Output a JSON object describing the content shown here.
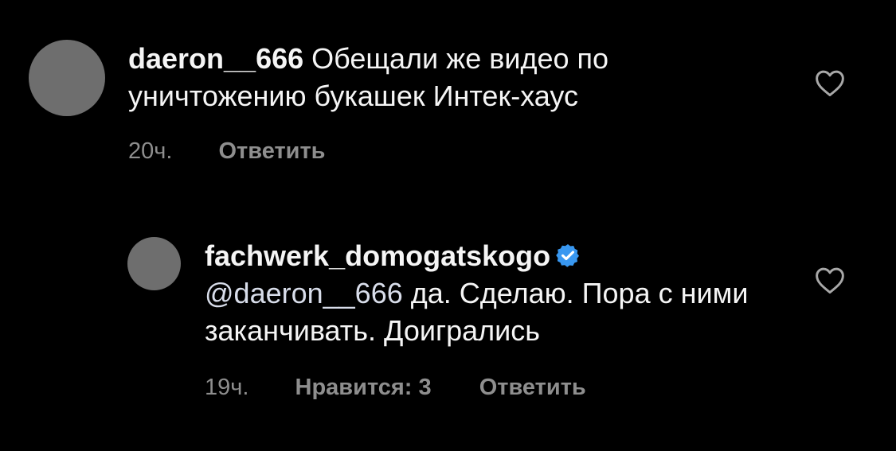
{
  "comments": [
    {
      "username": "daeron__666",
      "text": "Обещали же видео по уничтожению букашек Интек-хаус",
      "time": "20ч.",
      "reply_label": "Ответить"
    },
    {
      "username": "fachwerk_domogatskogo",
      "verified": true,
      "mention": "@daeron__666",
      "text": "да. Сделаю. Пора с ними заканчивать. Доигрались",
      "time": "19ч.",
      "likes_label": "Нравится: 3",
      "reply_label": "Ответить"
    }
  ],
  "icons": {
    "like": "heart-outline-icon",
    "verified": "verified-badge-icon"
  },
  "colors": {
    "background": "#000000",
    "text": "#f5f5f5",
    "meta": "#8e8e8e",
    "avatar": "#6e6e6e",
    "verified": "#3897f0"
  }
}
